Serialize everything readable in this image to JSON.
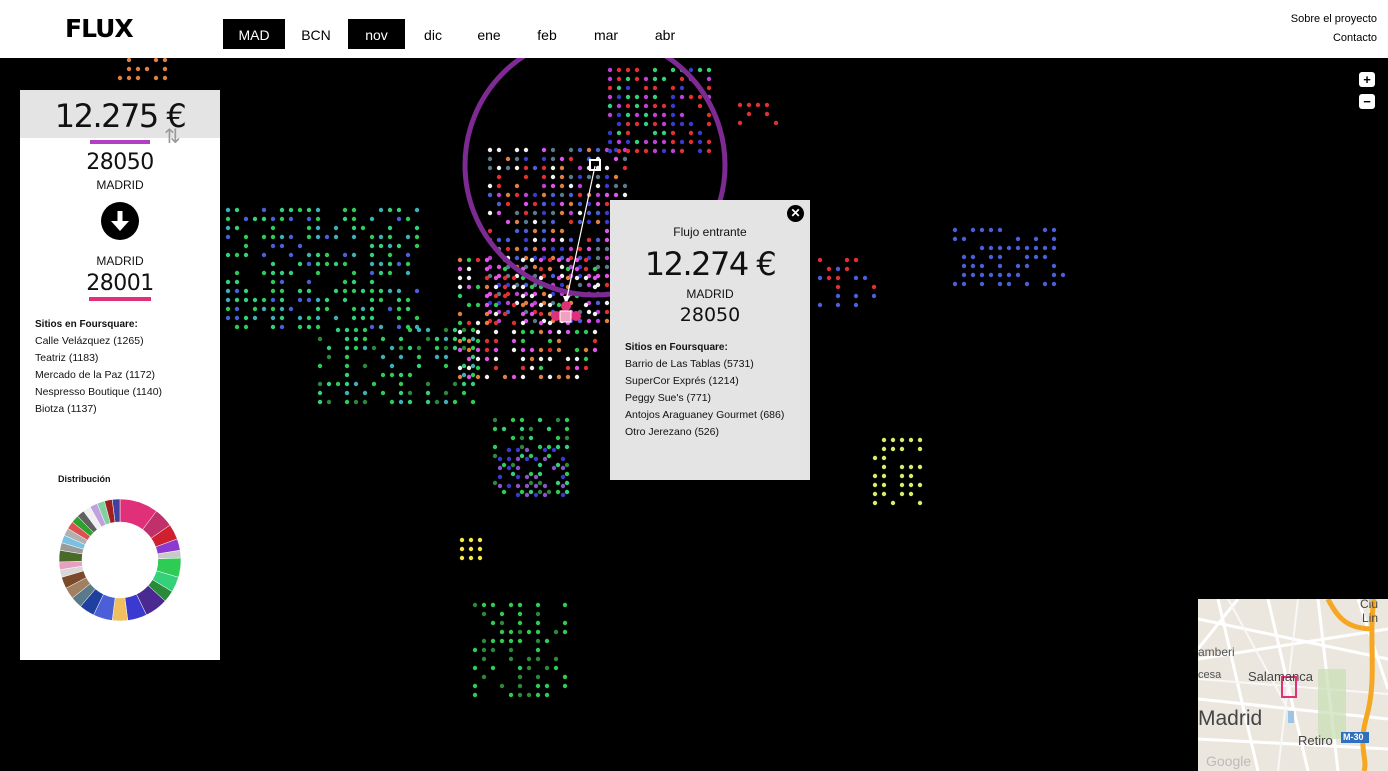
{
  "header": {
    "logo": "FLUX",
    "city_tabs": [
      {
        "label": "MAD",
        "active": true
      },
      {
        "label": "BCN",
        "active": false
      }
    ],
    "month_tabs": [
      {
        "label": "nov",
        "active": true
      },
      {
        "label": "dic",
        "active": false
      },
      {
        "label": "ene",
        "active": false
      },
      {
        "label": "feb",
        "active": false
      },
      {
        "label": "mar",
        "active": false
      },
      {
        "label": "abr",
        "active": false
      }
    ],
    "links": [
      "Sobre el proyecto",
      "Contacto"
    ]
  },
  "zoom": {
    "plus": "+",
    "minus": "−"
  },
  "left_panel": {
    "amount": "12.275 €",
    "origin": {
      "zip": "28050",
      "city": "MADRID",
      "color": "#b23fc4"
    },
    "destination": {
      "city": "MADRID",
      "zip": "28001",
      "color": "#e0307a"
    },
    "sites_title": "Sitios en Foursquare:",
    "sites": [
      "Calle Velázquez (1265)",
      "Teatriz (1183)",
      "Mercado de la Paz (1172)",
      "Nespresso Boutique (1140)",
      "Biotza (1137)"
    ],
    "distribution_title": "Distribución"
  },
  "popup": {
    "title": "Flujo entrante",
    "amount": "12.274 €",
    "city": "MADRID",
    "zip": "28050",
    "sites_title": "Sitios en Foursquare:",
    "sites": [
      "Barrio de Las Tablas (5731)",
      "SuperCor Exprés (1214)",
      "Peggy Sue's (771)",
      "Antojos Araguaney Gourmet (686)",
      "Otro Jerezano (526)"
    ]
  },
  "minimap": {
    "labels": [
      "amberi",
      "cesa",
      "Salamanca",
      "Madrid",
      "Retiro",
      "M-30",
      "Ciu",
      "Lin",
      "Google"
    ]
  },
  "colors": {
    "accent_purple": "#b23fc4",
    "accent_pink": "#e0307a",
    "background": "#000000"
  }
}
